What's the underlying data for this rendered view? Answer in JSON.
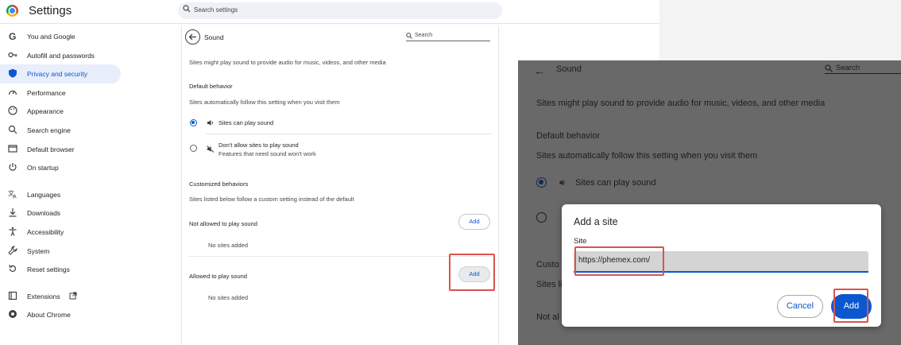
{
  "header": {
    "title": "Settings",
    "search_placeholder": "Search settings"
  },
  "sidebar": {
    "items": [
      {
        "label": "You and Google",
        "icon": "google-g-icon",
        "active": false
      },
      {
        "label": "Autofill and passwords",
        "icon": "key-icon",
        "active": false
      },
      {
        "label": "Privacy and security",
        "icon": "shield-icon",
        "active": true
      },
      {
        "label": "Performance",
        "icon": "speedometer-icon",
        "active": false
      },
      {
        "label": "Appearance",
        "icon": "palette-icon",
        "active": false
      },
      {
        "label": "Search engine",
        "icon": "search-icon",
        "active": false
      },
      {
        "label": "Default browser",
        "icon": "browser-window-icon",
        "active": false
      },
      {
        "label": "On startup",
        "icon": "power-icon",
        "active": false
      },
      {
        "label": "Languages",
        "icon": "translate-icon",
        "active": false
      },
      {
        "label": "Downloads",
        "icon": "download-icon",
        "active": false
      },
      {
        "label": "Accessibility",
        "icon": "accessibility-icon",
        "active": false
      },
      {
        "label": "System",
        "icon": "wrench-icon",
        "active": false
      },
      {
        "label": "Reset settings",
        "icon": "reset-icon",
        "active": false
      },
      {
        "label": "Extensions",
        "icon": "puzzle-icon",
        "active": false
      },
      {
        "label": "About Chrome",
        "icon": "chrome-icon",
        "active": false
      }
    ]
  },
  "sound": {
    "title": "Sound",
    "search_placeholder": "Search",
    "description": "Sites might play sound to provide audio for music, videos, and other media",
    "default_behavior": {
      "heading": "Default behavior",
      "subtext": "Sites automatically follow this setting when you visit them",
      "option_allow": "Sites can play sound",
      "option_block": "Don't allow sites to play sound",
      "option_block_sub": "Features that need sound won't work"
    },
    "customized": {
      "heading": "Customized behaviors",
      "subtext": "Sites listed below follow a custom setting instead of the default",
      "not_allowed_label": "Not allowed to play sound",
      "allowed_label": "Allowed to play sound",
      "no_sites": "No sites added",
      "add_label": "Add"
    }
  },
  "zoom": {
    "title": "Sound",
    "search_placeholder": "Search",
    "description": "Sites might play sound to provide audio for music, videos, and other media",
    "default_heading": "Default behavior",
    "default_subtext": "Sites automatically follow this setting when you visit them",
    "option_allow": "Sites can play sound",
    "custom_partial": "Custo",
    "sites_partial": "Sites li",
    "notal_partial": "Not al",
    "dialog": {
      "title": "Add a site",
      "field_label": "Site",
      "field_value": "https://phemex.com/",
      "cancel_label": "Cancel",
      "add_label": "Add"
    }
  },
  "colors": {
    "accent": "#0b57d0",
    "highlight_box": "#d9534f",
    "active_nav_bg": "#e8eefb"
  }
}
